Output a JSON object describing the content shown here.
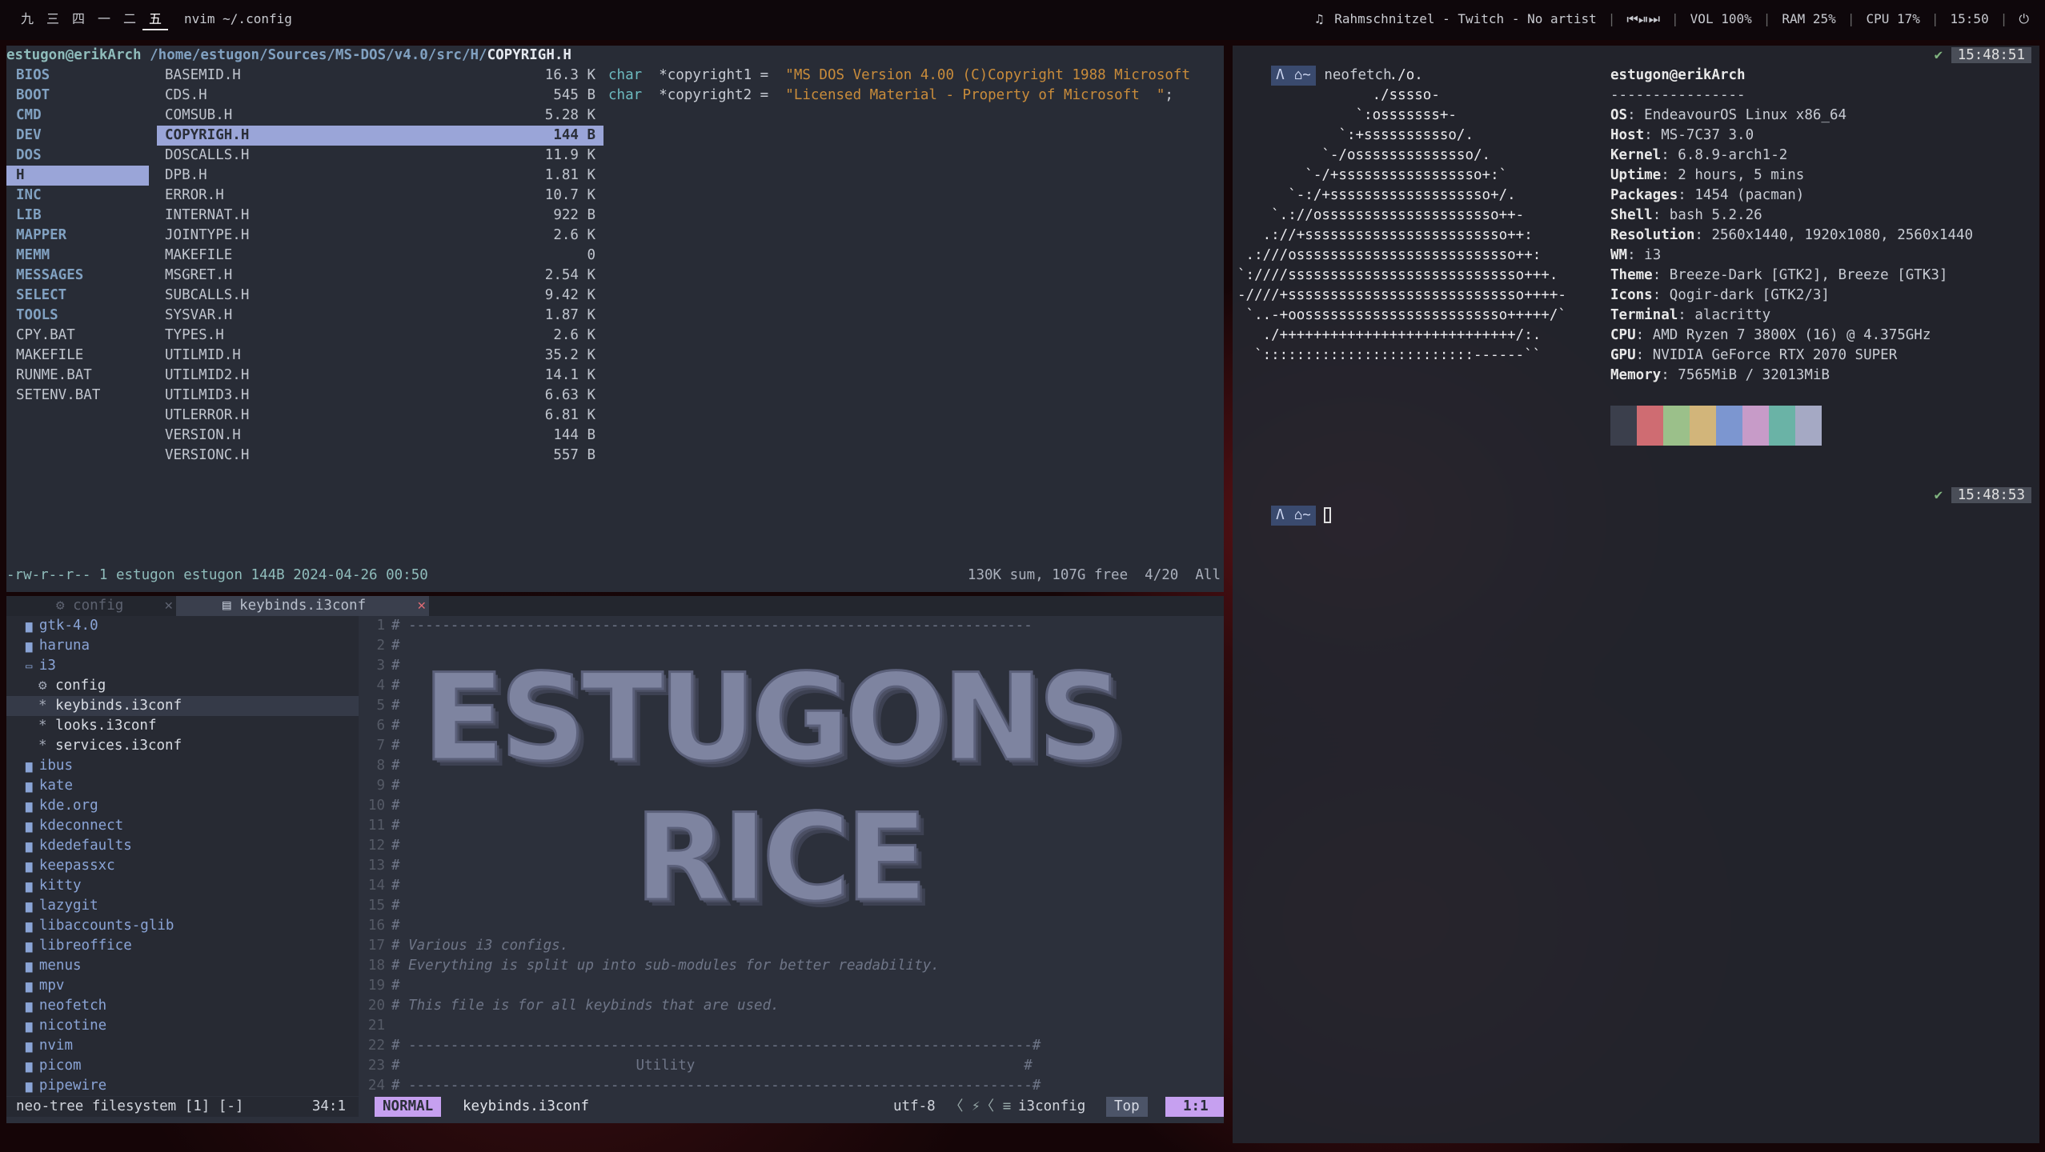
{
  "topbar": {
    "workspaces": [
      "九",
      "三",
      "四",
      "一",
      "二",
      "五"
    ],
    "active_workspace": 5,
    "window_title": "nvim ~/.config",
    "music_icon": "music-note-icon",
    "music": "Rahmschnitzel - Twitch - No artist",
    "media_controls": "⏮⏯⏭",
    "volume": "VOL 100%",
    "ram": "RAM 25%",
    "cpu": "CPU 17%",
    "clock": "15:50",
    "power_icon": "power-icon"
  },
  "ranger": {
    "path_user": "estugon@erikArch",
    "path_dir": "/home/estugon/Sources/MS-DOS/v4.0/src/H/",
    "path_file": "COPYRIGH.H",
    "left_col": [
      {
        "name": "BIOS",
        "type": "dir"
      },
      {
        "name": "BOOT",
        "type": "dir"
      },
      {
        "name": "CMD",
        "type": "dir"
      },
      {
        "name": "DEV",
        "type": "dir"
      },
      {
        "name": "DOS",
        "type": "dir"
      },
      {
        "name": "H",
        "type": "sel"
      },
      {
        "name": "INC",
        "type": "dir"
      },
      {
        "name": "LIB",
        "type": "dir"
      },
      {
        "name": "MAPPER",
        "type": "dir"
      },
      {
        "name": "MEMM",
        "type": "dir"
      },
      {
        "name": "MESSAGES",
        "type": "dir"
      },
      {
        "name": "SELECT",
        "type": "dir"
      },
      {
        "name": "TOOLS",
        "type": "dir"
      },
      {
        "name": "CPY.BAT",
        "type": "file"
      },
      {
        "name": "MAKEFILE",
        "type": "file"
      },
      {
        "name": "RUNME.BAT",
        "type": "file"
      },
      {
        "name": "SETENV.BAT",
        "type": "file"
      }
    ],
    "files": [
      {
        "name": "BASEMID.H",
        "size": "16.3 K"
      },
      {
        "name": "CDS.H",
        "size": "545 B"
      },
      {
        "name": "COMSUB.H",
        "size": "5.28 K"
      },
      {
        "name": "COPYRIGH.H",
        "size": "144 B",
        "selected": true
      },
      {
        "name": "DOSCALLS.H",
        "size": "11.9 K"
      },
      {
        "name": "DPB.H",
        "size": "1.81 K"
      },
      {
        "name": "ERROR.H",
        "size": "10.7 K"
      },
      {
        "name": "INTERNAT.H",
        "size": "922 B"
      },
      {
        "name": "JOINTYPE.H",
        "size": "2.6 K"
      },
      {
        "name": "MAKEFILE",
        "size": "0"
      },
      {
        "name": "MSGRET.H",
        "size": "2.54 K"
      },
      {
        "name": "SUBCALLS.H",
        "size": "9.42 K"
      },
      {
        "name": "SYSVAR.H",
        "size": "1.87 K"
      },
      {
        "name": "TYPES.H",
        "size": "2.6 K"
      },
      {
        "name": "UTILMID.H",
        "size": "35.2 K"
      },
      {
        "name": "UTILMID2.H",
        "size": "14.1 K"
      },
      {
        "name": "UTILMID3.H",
        "size": "6.63 K"
      },
      {
        "name": "UTLERROR.H",
        "size": "6.81 K"
      },
      {
        "name": "VERSION.H",
        "size": "144 B"
      },
      {
        "name": "VERSIONC.H",
        "size": "557 B"
      }
    ],
    "preview": [
      {
        "kw": "char",
        "decl": "  *copyright1 =  ",
        "str": "\"MS DOS Version 4.00 (C)Copyright 1988 Microsoft"
      },
      {
        "kw": "char",
        "decl": "  *copyright2 =  ",
        "str": "\"Licensed Material - Property of Microsoft  \"",
        "tail": ";"
      }
    ],
    "status_left": "-rw-r--r-- 1 estugon estugon 144B 2024-04-26 00:50",
    "status_right": "130K sum, 107G free  4/20  All"
  },
  "nvim": {
    "tabs": [
      {
        "label": "config",
        "icon": "gear-icon",
        "active": false
      },
      {
        "label": "keybinds.i3conf",
        "icon": "file-icon",
        "active": true
      }
    ],
    "tab_close": "✕",
    "tree": [
      {
        "label": "gtk-4.0",
        "kind": "dir",
        "depth": 0
      },
      {
        "label": "haruna",
        "kind": "dir",
        "depth": 0
      },
      {
        "label": "i3",
        "kind": "open",
        "depth": 0
      },
      {
        "label": "config",
        "kind": "gear",
        "depth": 1
      },
      {
        "label": "keybinds.i3conf",
        "kind": "star",
        "depth": 1,
        "selected": true
      },
      {
        "label": "looks.i3conf",
        "kind": "star",
        "depth": 1
      },
      {
        "label": "services.i3conf",
        "kind": "star",
        "depth": 1
      },
      {
        "label": "ibus",
        "kind": "dir",
        "depth": 0
      },
      {
        "label": "kate",
        "kind": "dir",
        "depth": 0
      },
      {
        "label": "kde.org",
        "kind": "dir",
        "depth": 0
      },
      {
        "label": "kdeconnect",
        "kind": "dir",
        "depth": 0
      },
      {
        "label": "kdedefaults",
        "kind": "dir",
        "depth": 0
      },
      {
        "label": "keepassxc",
        "kind": "dir",
        "depth": 0
      },
      {
        "label": "kitty",
        "kind": "dir",
        "depth": 0
      },
      {
        "label": "lazygit",
        "kind": "dir",
        "depth": 0
      },
      {
        "label": "libaccounts-glib",
        "kind": "dir",
        "depth": 0
      },
      {
        "label": "libreoffice",
        "kind": "dir",
        "depth": 0
      },
      {
        "label": "menus",
        "kind": "dir",
        "depth": 0
      },
      {
        "label": "mpv",
        "kind": "dir",
        "depth": 0
      },
      {
        "label": "neofetch",
        "kind": "dir",
        "depth": 0
      },
      {
        "label": "nicotine",
        "kind": "dir",
        "depth": 0
      },
      {
        "label": "nvim",
        "kind": "dir",
        "depth": 0
      },
      {
        "label": "picom",
        "kind": "dir",
        "depth": 0
      },
      {
        "label": "pipewire",
        "kind": "dir",
        "depth": 0
      }
    ],
    "code": [
      "# --------------------------------------------------------------------------",
      "#",
      "#",
      "#",
      "#",
      "#",
      "#",
      "#",
      "#",
      "#",
      "#",
      "#",
      "#",
      "#",
      "#",
      "#",
      "# Various i3 configs.",
      "# Everything is split up into sub-modules for better readability.",
      "#",
      "# This file is for all keybinds that are used.",
      "",
      "# --------------------------------------------------------------------------#",
      "#                            Utility                                       #",
      "# --------------------------------------------------------------------------#"
    ],
    "banner_line1": "ESTUGONS",
    "banner_line2": "RICE",
    "tree_status_left": "neo-tree filesystem [1] [-]",
    "tree_status_right": "34:1",
    "mode": "NORMAL",
    "filename": "keybinds.i3conf",
    "encoding": "utf-8",
    "filetype": "i3config",
    "scroll": "Top",
    "position": "1:1"
  },
  "term": {
    "prompt_dir": "~",
    "command": "neofetch",
    "check": "✔",
    "time1": "15:48:51",
    "time2": "15:48:53",
    "logo": [
      "                  ./o.",
      "                ./sssso-",
      "              `:osssssss+-",
      "            `:+sssssssssso/.",
      "          `-/ossssssssssssso/.",
      "        `-/+sssssssssssssssso+:`",
      "      `-:/+sssssssssssssssssso+/.",
      "    `.://osssssssssssssssssssso++-",
      "   .://+ssssssssssssssssssssssso++:",
      " .:///ossssssssssssssssssssssssso++:",
      "`:////ssssssssssssssssssssssssssso+++.",
      "-////+ssssssssssssssssssssssssssso++++-",
      " `..-+oossssssssssssssssssssssso+++++/`",
      "   ./++++++++++++++++++++++++++++/:.",
      "  `:::::::::::::::::::::::::------``"
    ],
    "user_host": "estugon@erikArch",
    "separator": "----------------",
    "info": [
      {
        "k": "OS",
        "v": "EndeavourOS Linux x86_64"
      },
      {
        "k": "Host",
        "v": "MS-7C37 3.0"
      },
      {
        "k": "Kernel",
        "v": "6.8.9-arch1-2"
      },
      {
        "k": "Uptime",
        "v": "2 hours, 5 mins"
      },
      {
        "k": "Packages",
        "v": "1454 (pacman)"
      },
      {
        "k": "Shell",
        "v": "bash 5.2.26"
      },
      {
        "k": "Resolution",
        "v": "2560x1440, 1920x1080, 2560x1440"
      },
      {
        "k": "WM",
        "v": "i3"
      },
      {
        "k": "Theme",
        "v": "Breeze-Dark [GTK2], Breeze [GTK3]"
      },
      {
        "k": "Icons",
        "v": "Qogir-dark [GTK2/3]"
      },
      {
        "k": "Terminal",
        "v": "alacritty"
      },
      {
        "k": "CPU",
        "v": "AMD Ryzen 7 3800X (16) @ 4.375GHz"
      },
      {
        "k": "GPU",
        "v": "NVIDIA GeForce RTX 2070 SUPER"
      },
      {
        "k": "Memory",
        "v": "7565MiB / 32013MiB"
      }
    ],
    "palette": [
      "#3b3f4c",
      "#cf6c72",
      "#9bc08a",
      "#d2b57a",
      "#7c96d0",
      "#c79bc8",
      "#6ab3a6",
      "#a5a9c4"
    ]
  }
}
